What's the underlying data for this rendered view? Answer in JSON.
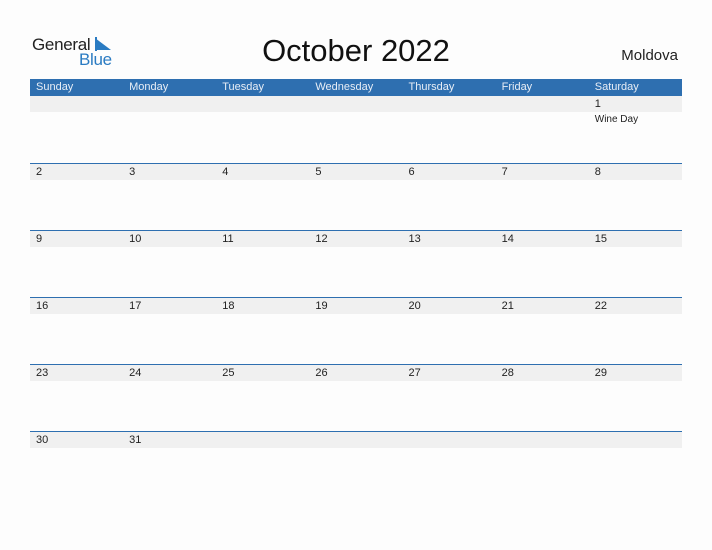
{
  "logo": {
    "word1": "General",
    "word2": "Blue"
  },
  "header": {
    "title": "October 2022",
    "country": "Moldova"
  },
  "colors": {
    "accent": "#2e6fb0",
    "logo_blue": "#2a7bc2",
    "day_strip": "#f0f0f0"
  },
  "weekdays": [
    "Sunday",
    "Monday",
    "Tuesday",
    "Wednesday",
    "Thursday",
    "Friday",
    "Saturday"
  ],
  "weeks": [
    {
      "days": [
        "",
        "",
        "",
        "",
        "",
        "",
        "1"
      ],
      "events": [
        "",
        "",
        "",
        "",
        "",
        "",
        "Wine Day"
      ]
    },
    {
      "days": [
        "2",
        "3",
        "4",
        "5",
        "6",
        "7",
        "8"
      ],
      "events": [
        "",
        "",
        "",
        "",
        "",
        "",
        ""
      ]
    },
    {
      "days": [
        "9",
        "10",
        "11",
        "12",
        "13",
        "14",
        "15"
      ],
      "events": [
        "",
        "",
        "",
        "",
        "",
        "",
        ""
      ]
    },
    {
      "days": [
        "16",
        "17",
        "18",
        "19",
        "20",
        "21",
        "22"
      ],
      "events": [
        "",
        "",
        "",
        "",
        "",
        "",
        ""
      ]
    },
    {
      "days": [
        "23",
        "24",
        "25",
        "26",
        "27",
        "28",
        "29"
      ],
      "events": [
        "",
        "",
        "",
        "",
        "",
        "",
        ""
      ]
    },
    {
      "days": [
        "30",
        "31",
        "",
        "",
        "",
        "",
        ""
      ],
      "events": [
        "",
        "",
        "",
        "",
        "",
        "",
        ""
      ]
    }
  ]
}
